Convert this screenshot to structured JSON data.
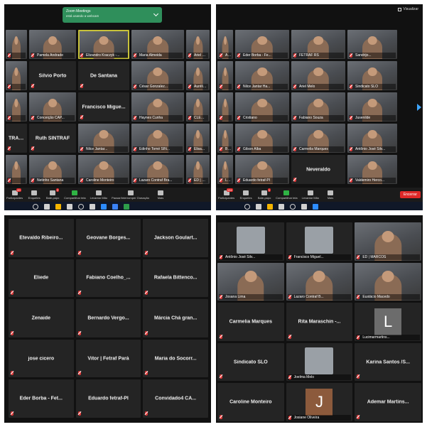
{
  "notification": {
    "title": "Zoom Meetings",
    "message": "está usando a webcam"
  },
  "top_left": {
    "tiles": [
      {
        "name": "",
        "kind": "video"
      },
      {
        "name": "Pamela Andrade",
        "kind": "video"
      },
      {
        "name": "Elizandro Kraczyk -...",
        "kind": "video",
        "active": true
      },
      {
        "name": "Maria Almeida",
        "kind": "video"
      },
      {
        "name": "Ariel Melo",
        "kind": "video"
      },
      {
        "name": "",
        "kind": "video"
      },
      {
        "name": "Silvio Porto",
        "kind": "name"
      },
      {
        "name": "De Santana",
        "kind": "name"
      },
      {
        "name": "César Gonzalez...",
        "kind": "video"
      },
      {
        "name": "Aurélia ...",
        "kind": "video"
      },
      {
        "name": "",
        "kind": "video"
      },
      {
        "name": "Conceição CAP...",
        "kind": "video"
      },
      {
        "name": "Francisco Migue...",
        "kind": "name"
      },
      {
        "name": "Haynes Cunha",
        "kind": "video"
      },
      {
        "name": "CLEONI C...",
        "kind": "video"
      },
      {
        "name": "TRAF RN",
        "kind": "name"
      },
      {
        "name": "Ruth SINTRAF",
        "kind": "name"
      },
      {
        "name": "Nilce Jantar...",
        "kind": "video"
      },
      {
        "name": "Edinho Tomé SIN...",
        "kind": "video"
      },
      {
        "name": "Elisa...",
        "kind": "video"
      },
      {
        "name": "",
        "kind": "video"
      },
      {
        "name": "Netinho Santana",
        "kind": "video"
      },
      {
        "name": "Caroline Monteiro",
        "kind": "video"
      },
      {
        "name": "Lazaro Contraf Bra...",
        "kind": "video"
      },
      {
        "name": "ED | MARC...",
        "kind": "video"
      }
    ],
    "toolbar": [
      {
        "label": "Participantes",
        "badge": "49"
      },
      {
        "label": "Enquetes",
        "badge": ""
      },
      {
        "label": "Bate-papo",
        "badge": "2"
      },
      {
        "label": "Compartilhar tela",
        "badge": "",
        "green": true
      },
      {
        "label": "Levantar Mão",
        "badge": ""
      },
      {
        "label": "Pausar/Interromper Gravação",
        "badge": ""
      },
      {
        "label": "Mais",
        "badge": ""
      }
    ]
  },
  "top_right": {
    "view_label": "Visualizar",
    "tiles": [
      {
        "name": "Andrade",
        "kind": "video"
      },
      {
        "name": "Eder Borba - Fe...",
        "kind": "video"
      },
      {
        "name": "FETRAF RS",
        "kind": "video"
      },
      {
        "name": "Sandrijo...",
        "kind": "video"
      },
      {
        "name": "",
        "kind": "video"
      },
      {
        "name": "Nilce Jantar Ha...",
        "kind": "video"
      },
      {
        "name": "Ariel Melo",
        "kind": "video"
      },
      {
        "name": "Sindicato SLO",
        "kind": "video"
      },
      {
        "name": "",
        "kind": "video"
      },
      {
        "name": "Cristiano",
        "kind": "video"
      },
      {
        "name": "Fabiano Souza",
        "kind": "video"
      },
      {
        "name": "Jusenilde",
        "kind": "video"
      },
      {
        "name": "Bea...",
        "kind": "video"
      },
      {
        "name": "Gilson Alba",
        "kind": "video"
      },
      {
        "name": "Carmelia Marques",
        "kind": "video"
      },
      {
        "name": "Antônio José Silv...",
        "kind": "video"
      },
      {
        "name": "Lurdes",
        "kind": "video"
      },
      {
        "name": "Eduardo fetraf-PI",
        "kind": "video"
      },
      {
        "name": "Neveraldo",
        "kind": "name"
      },
      {
        "name": "Valdemiro Herco...",
        "kind": "video"
      }
    ],
    "toolbar": [
      {
        "label": "Participantes",
        "badge": "104"
      },
      {
        "label": "Enquetes",
        "badge": ""
      },
      {
        "label": "Bate-papo",
        "badge": "1"
      },
      {
        "label": "Compartilhar tela",
        "badge": "",
        "green": true
      },
      {
        "label": "Levantar Mão",
        "badge": ""
      },
      {
        "label": "Mais",
        "badge": ""
      }
    ],
    "end_label": "Encerrar"
  },
  "bottom_left": {
    "tiles": [
      "Etevaldo Ribeiro...",
      "Geovane Borges...",
      "Jackson Goulart...",
      "Eliede",
      "Fabiano Coelho_...",
      "Rafaela Bittenco...",
      "Zenaide",
      "Bernardo Vergo...",
      "Márcia Chá gran...",
      "jose cicero",
      "Vitor | Fetraf Pará",
      "Maria do Socorr...",
      "Eder Borba - Fet...",
      "Eduardo fetraf-PI",
      "Convidado4 CA..."
    ]
  },
  "bottom_right": {
    "tiles": [
      {
        "name": "Antônio José Silv...",
        "kind": "photo"
      },
      {
        "name": "Francisco Miguel...",
        "kind": "photo"
      },
      {
        "name": "ED | MARCOS",
        "kind": "video"
      },
      {
        "name": "Josana Lima",
        "kind": "video"
      },
      {
        "name": "Lazaro Contraf B...",
        "kind": "video"
      },
      {
        "name": "Eustácio Macedo",
        "kind": "video"
      },
      {
        "name": "Carmelia Marques",
        "kind": "name"
      },
      {
        "name": "Rita Maraschin -...",
        "kind": "name"
      },
      {
        "name": "Lucimarmartins...",
        "kind": "letter",
        "letter": "L"
      },
      {
        "name": "Sindicato SLO",
        "kind": "name"
      },
      {
        "name": "Joelma Melo",
        "kind": "photo"
      },
      {
        "name": "Karina Santos /S...",
        "kind": "name"
      },
      {
        "name": "Caroline Monteiro",
        "kind": "name"
      },
      {
        "name": "Josiane Oliveira",
        "kind": "letter",
        "letter": "J",
        "brown": true
      },
      {
        "name": "Ademar Martins...",
        "kind": "name"
      }
    ]
  },
  "colors": {
    "active_speaker": "#c8c23a",
    "end_button": "#e02828",
    "notification": "#2f8f5b"
  }
}
